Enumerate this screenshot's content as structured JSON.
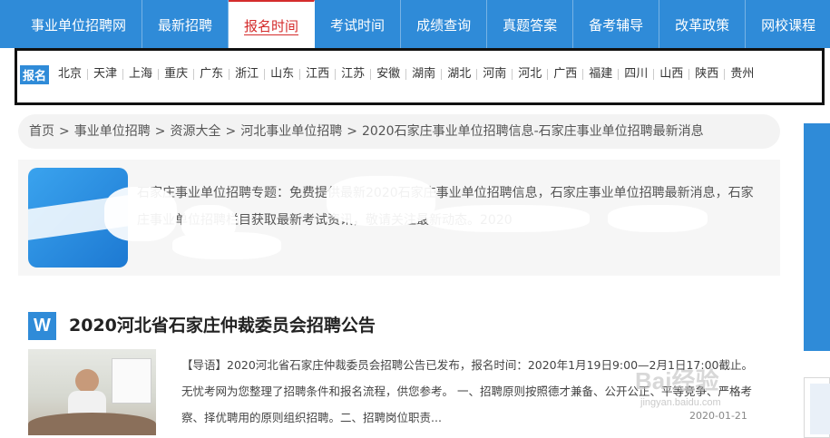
{
  "nav": {
    "items": [
      {
        "label": "事业单位招聘网"
      },
      {
        "label": "最新招聘"
      },
      {
        "label": "报名时间"
      },
      {
        "label": "考试时间"
      },
      {
        "label": "成绩查询"
      },
      {
        "label": "真题答案"
      },
      {
        "label": "备考辅导"
      },
      {
        "label": "改革政策"
      },
      {
        "label": "网校课程"
      }
    ],
    "active_label": "报名时间"
  },
  "regions": {
    "tag": "报名",
    "provinces": [
      "北京",
      "天津",
      "上海",
      "重庆",
      "广东",
      "浙江",
      "山东",
      "江西",
      "江苏",
      "安徽",
      "湖南",
      "湖北",
      "河南",
      "河北",
      "广西",
      "福建",
      "四川",
      "山西",
      "陕西",
      "贵州"
    ]
  },
  "breadcrumb": {
    "items": [
      "首页",
      "事业单位招聘",
      "资源大全",
      "河北事业单位招聘",
      "2020石家庄事业单位招聘信息-石家庄事业单位招聘最新消息"
    ],
    "separator": ">"
  },
  "intro": {
    "text": "石家庄事业单位招聘专题：免费提供最新2020石家庄事业单位招聘信息，石家庄事业单位招聘最新消息，石家庄事业单位招聘栏目获取最新考试资讯，敬请关注最新动态。2020"
  },
  "article": {
    "icon_letter": "W",
    "title": "2020河北省石家庄仲裁委员会招聘公告",
    "summary": "【导语】2020河北省石家庄仲裁委员会招聘公告已发布，报名时间：2020年1月19日9:00—2月1日17:00截止。无忧考网为您整理了招聘条件和报名流程，供您参考。 一、招聘原则按照德才兼备、公开公正、平等竞争、严格考察、择优聘用的原则组织招聘。二、招聘岗位职责...",
    "date": "2020-01-21"
  },
  "watermark": {
    "text": "Bai经验",
    "sub": "jingyan.baidu.com"
  }
}
